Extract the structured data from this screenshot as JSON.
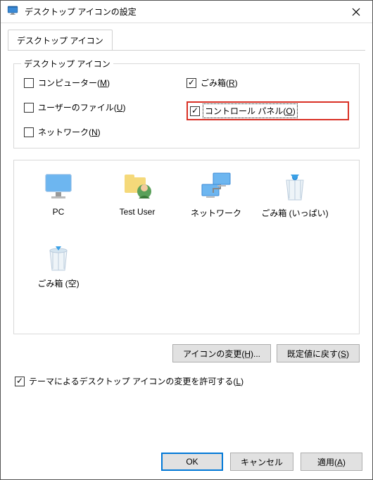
{
  "window": {
    "title": "デスクトップ アイコンの設定"
  },
  "tab": {
    "label": "デスクトップ アイコン"
  },
  "group": {
    "title": "デスクトップ アイコン"
  },
  "checks": {
    "computer": {
      "label_pre": "コンピューター(",
      "k": "M",
      "label_post": ")",
      "checked": false
    },
    "userfiles": {
      "label_pre": "ユーザーのファイル(",
      "k": "U",
      "label_post": ")",
      "checked": false
    },
    "network": {
      "label_pre": "ネットワーク(",
      "k": "N",
      "label_post": ")",
      "checked": false
    },
    "recycle": {
      "label_pre": "ごみ箱(",
      "k": "R",
      "label_post": ")",
      "checked": true
    },
    "cpanel": {
      "label_pre": "コントロール パネル(",
      "k": "O",
      "label_post": ")",
      "checked": true
    }
  },
  "icons": {
    "pc": "PC",
    "user": "Test User",
    "net": "ネットワーク",
    "rb_full": "ごみ箱 (いっぱい)",
    "rb_empty": "ごみ箱 (空)"
  },
  "buttons": {
    "change": "アイコンの変更(H̲)...",
    "reset": "既定値に戻す(S̲)",
    "ok": "OK",
    "cancel": "キャンセル",
    "apply": "適用(A̲)"
  },
  "themechk": {
    "label_pre": "テーマによるデスクトップ アイコンの変更を許可する(",
    "k": "L",
    "label_post": ")",
    "checked": true
  }
}
